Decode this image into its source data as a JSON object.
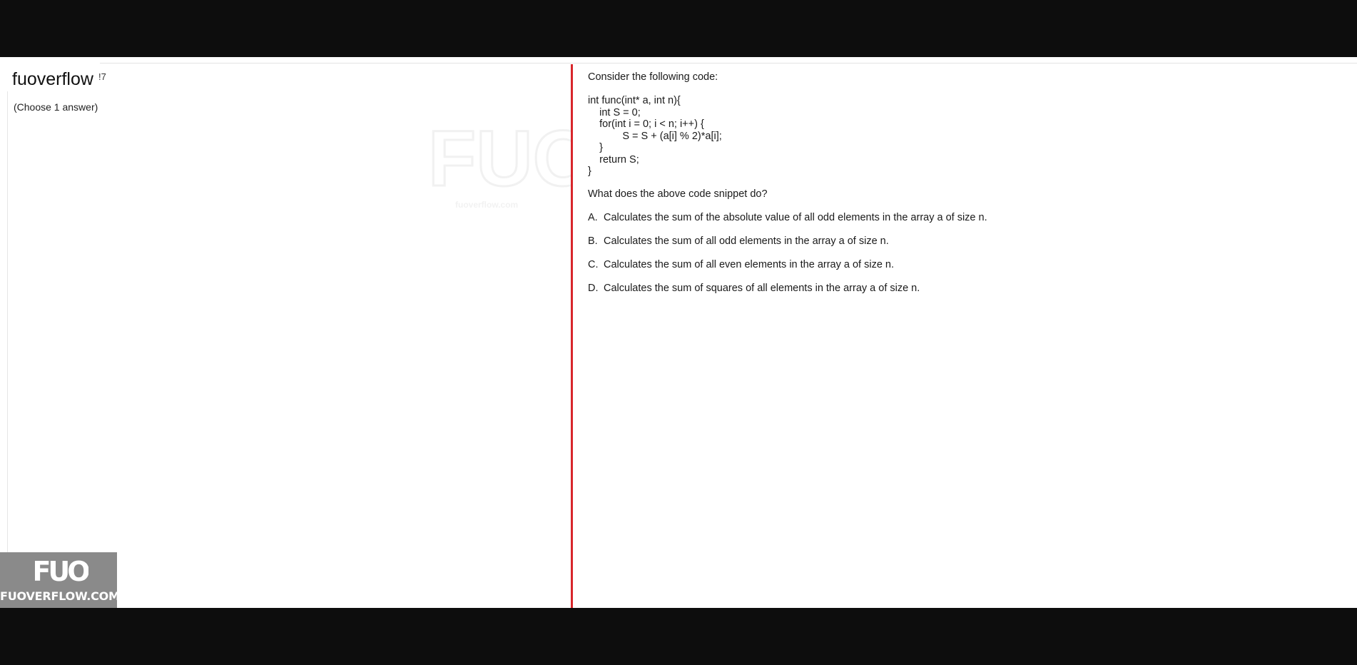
{
  "header": {
    "brand": "fuoverflow",
    "question_number_fragment": "!7",
    "instruction": "(Choose 1 answer)"
  },
  "watermark": {
    "text": "fuoverflow.com"
  },
  "question": {
    "intro": "Consider the following code:",
    "code_lines": [
      "int func(int* a, int n){",
      "    int S = 0;",
      "    for(int i = 0; i < n; i++) {",
      "            S = S + (a[i] % 2)*a[i];",
      "    }",
      "    return S;",
      "}"
    ],
    "prompt": "What does the above code snippet do?",
    "options": [
      {
        "letter": "A.",
        "text": "Calculates the sum of the absolute value of all odd elements in the array a of size n."
      },
      {
        "letter": "B.",
        "text": "Calculates the sum of all odd elements in the array a of size n."
      },
      {
        "letter": "C.",
        "text": "Calculates the sum of all even elements in the array a of size n."
      },
      {
        "letter": "D.",
        "text": "Calculates the sum of squares of all elements in the array a of size n."
      }
    ]
  },
  "badge": {
    "logo_text": "FUO",
    "site": "FUOVERFLOW.COM"
  },
  "colors": {
    "divider": "#d8262b",
    "background": "#ffffff",
    "frame": "#0d0d0d"
  }
}
